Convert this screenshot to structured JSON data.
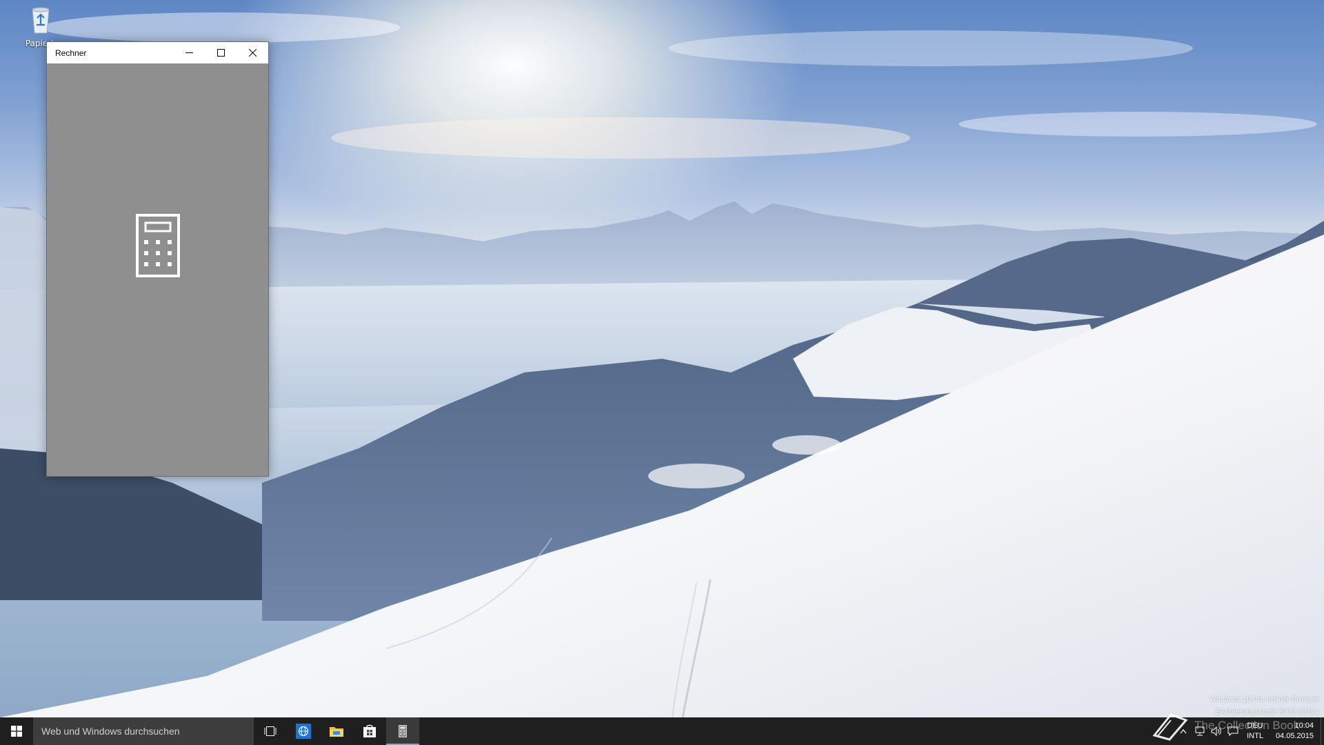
{
  "desktop": {
    "recycle_bin_label": "Papierk"
  },
  "window": {
    "title": "Rechner",
    "minimize_label": "Minimieren",
    "maximize_label": "Maximieren",
    "close_label": "Schließen",
    "background": "#8f8f8f"
  },
  "watermark": {
    "line1": "Windows 10 Pro Insider Preview",
    "line2": "Evaluierungskopie Build 10114",
    "brand": "The Collection Book"
  },
  "taskbar": {
    "search_placeholder": "Web und Windows durchsuchen",
    "pinned": [
      {
        "name": "task-view",
        "icon": "task-view-icon"
      },
      {
        "name": "edge",
        "icon": "globe-icon",
        "color": "#1a74d4"
      },
      {
        "name": "file-explorer",
        "icon": "folder-icon",
        "color": "#f2c230"
      },
      {
        "name": "store",
        "icon": "store-icon"
      },
      {
        "name": "calculator",
        "icon": "calculator-icon",
        "active": true
      }
    ],
    "tray": {
      "lang_line1": "DEU",
      "lang_line2": "INTL",
      "time": "10:04",
      "date": "04.05.2015"
    }
  }
}
